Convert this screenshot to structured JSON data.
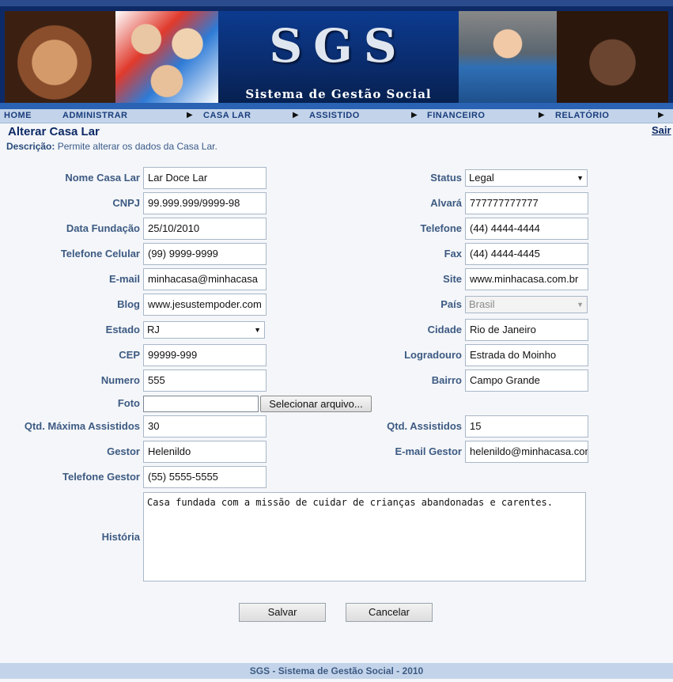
{
  "banner": {
    "title": "SGS",
    "subtitle": "Sistema de Gestão Social"
  },
  "nav": {
    "items": [
      "HOME",
      "ADMINISTRAR",
      "CASA LAR",
      "ASSISTIDO",
      "FINANCEIRO",
      "RELATÓRIO"
    ]
  },
  "page": {
    "title": "Alterar Casa Lar",
    "logout": "Sair",
    "desc_label": "Descrição:",
    "desc_text": "Permite alterar os dados da Casa Lar."
  },
  "form": {
    "nome": {
      "label": "Nome Casa Lar",
      "value": "Lar Doce Lar"
    },
    "status": {
      "label": "Status",
      "value": "Legal"
    },
    "cnpj": {
      "label": "CNPJ",
      "value": "99.999.999/9999-98"
    },
    "alvara": {
      "label": "Alvará",
      "value": "777777777777"
    },
    "data_fundacao": {
      "label": "Data Fundação",
      "value": "25/10/2010"
    },
    "telefone": {
      "label": "Telefone",
      "value": "(44) 4444-4444"
    },
    "celular": {
      "label": "Telefone Celular",
      "value": "(99) 9999-9999"
    },
    "fax": {
      "label": "Fax",
      "value": "(44) 4444-4445"
    },
    "email": {
      "label": "E-mail",
      "value": "minhacasa@minhacasa"
    },
    "site": {
      "label": "Site",
      "value": "www.minhacasa.com.br"
    },
    "blog": {
      "label": "Blog",
      "value": "www.jesustempoder.com"
    },
    "pais": {
      "label": "País",
      "value": "Brasil"
    },
    "estado": {
      "label": "Estado",
      "value": "RJ"
    },
    "cidade": {
      "label": "Cidade",
      "value": "Rio de Janeiro"
    },
    "cep": {
      "label": "CEP",
      "value": "99999-999"
    },
    "logradouro": {
      "label": "Logradouro",
      "value": "Estrada do Moinho"
    },
    "numero": {
      "label": "Numero",
      "value": "555"
    },
    "bairro": {
      "label": "Bairro",
      "value": "Campo Grande"
    },
    "foto": {
      "label": "Foto",
      "button": "Selecionar arquivo..."
    },
    "qtd_max": {
      "label": "Qtd. Máxima Assistidos",
      "value": "30"
    },
    "qtd_assistidos": {
      "label": "Qtd. Assistidos",
      "value": "15"
    },
    "gestor": {
      "label": "Gestor",
      "value": "Helenildo"
    },
    "email_gestor": {
      "label": "E-mail Gestor",
      "value": "helenildo@minhacasa.com"
    },
    "tel_gestor": {
      "label": "Telefone Gestor",
      "value": "(55) 5555-5555"
    },
    "historia": {
      "label": "História",
      "value": "Casa fundada com a missão de cuidar de crianças abandonadas e carentes."
    }
  },
  "actions": {
    "save": "Salvar",
    "cancel": "Cancelar"
  },
  "footer": {
    "text": "SGS - Sistema de Gestão Social - 2010"
  }
}
